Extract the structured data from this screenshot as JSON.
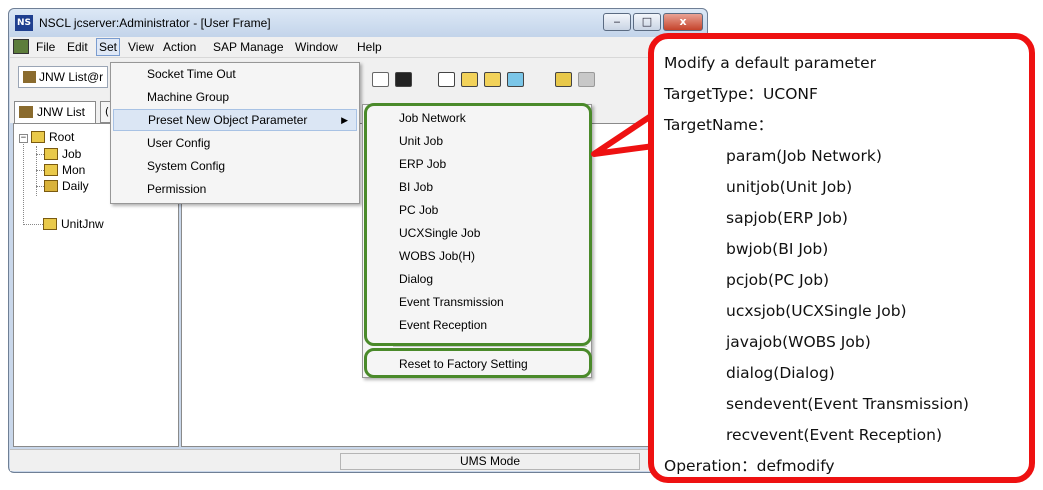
{
  "window": {
    "title": "NSCL jcserver:Administrator - [User Frame]",
    "app_icon_text": "NS",
    "controls": {
      "minimize": "‒",
      "maximize": "□",
      "close": "x"
    }
  },
  "menubar": {
    "items": [
      "File",
      "Edit",
      "Set",
      "View",
      "Action",
      "SAP Manage",
      "Window",
      "Help"
    ]
  },
  "toolbar": {
    "combo_value": "JNW List@r"
  },
  "tabs": {
    "active": "JNW List",
    "next": "("
  },
  "tree": {
    "root": "Root",
    "children": [
      "Job",
      "Mon",
      "Daily"
    ],
    "other": "UnitJnw"
  },
  "set_menu": {
    "items": [
      "Socket Time Out",
      "Machine Group",
      "Preset New Object Parameter",
      "User Config",
      "System Config",
      "Permission"
    ]
  },
  "submenu": {
    "items": [
      "Job Network",
      "Unit Job",
      "ERP Job",
      "BI Job",
      "PC Job",
      "UCXSingle Job",
      "WOBS Job(H)",
      "Dialog",
      "Event Transmission",
      "Event Reception"
    ],
    "reset": "Reset to Factory Setting"
  },
  "status": {
    "mode": "UMS Mode"
  },
  "callout": {
    "heading": "Modify a default parameter",
    "target_type": "TargetType：UCONF",
    "target_name_label": "TargetName：",
    "target_names": [
      "param(Job Network)",
      "unitjob(Unit Job)",
      "sapjob(ERP Job)",
      "bwjob(BI Job)",
      "pcjob(PC Job)",
      "ucxsjob(UCXSingle Job)",
      "javajob(WOBS Job)",
      "dialog(Dialog)",
      "sendevent(Event Transmission)",
      "recvevent(Event Reception)"
    ],
    "operation": "Operation：defmodify"
  },
  "colors": {
    "callout_border": "#ee1111",
    "highlight_border": "#4a8a2a"
  }
}
